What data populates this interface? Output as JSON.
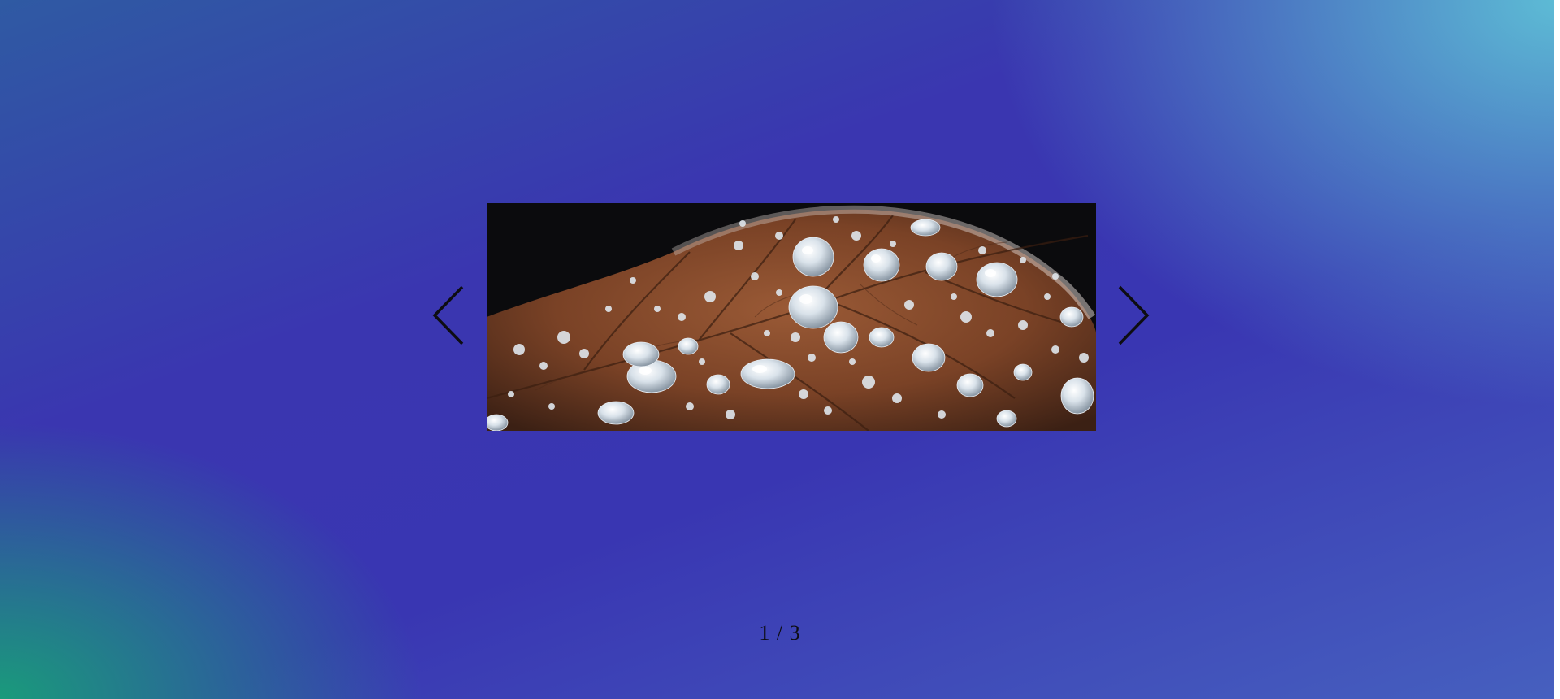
{
  "carousel": {
    "slide_image": "water-droplets-on-leaf-photo",
    "counter": "1 / 3",
    "current_slide": 1,
    "total_slides": 3
  },
  "icons": {
    "prev": "chevron-left-icon",
    "next": "chevron-right-icon"
  },
  "colors": {
    "gradient_blue": "#3936b2",
    "gradient_teal": "#18a078",
    "gradient_cyan": "#5fc3d7",
    "arrow": "#0d0d12"
  }
}
